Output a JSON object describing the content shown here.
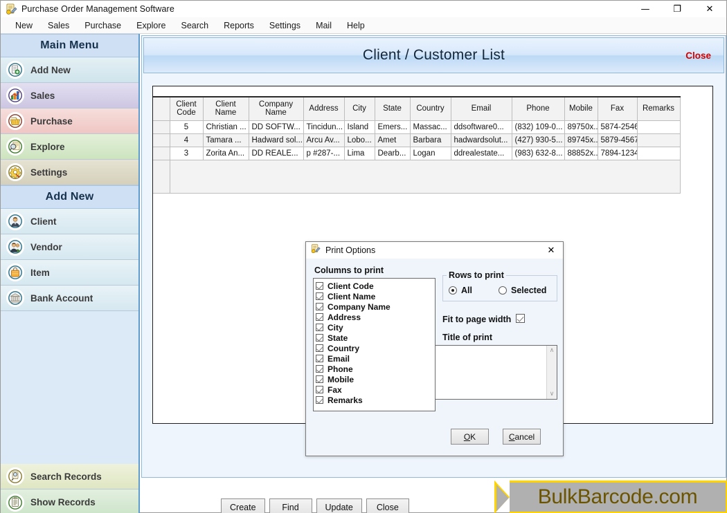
{
  "window": {
    "title": "Purchase Order Management Software",
    "icon": "app-icon",
    "minimize": "—",
    "restore": "❐",
    "close": "✕"
  },
  "menubar": {
    "items": [
      {
        "label": "New"
      },
      {
        "label": "Sales"
      },
      {
        "label": "Purchase"
      },
      {
        "label": "Explore"
      },
      {
        "label": "Search"
      },
      {
        "label": "Reports"
      },
      {
        "label": "Settings"
      },
      {
        "label": "Mail"
      },
      {
        "label": "Help"
      }
    ]
  },
  "sidebar": {
    "main_menu_header": "Main Menu",
    "main_items": [
      {
        "label": "Add New",
        "icon": "document-add-icon"
      },
      {
        "label": "Sales",
        "icon": "bar-chart-icon"
      },
      {
        "label": "Purchase",
        "icon": "basket-icon"
      },
      {
        "label": "Explore",
        "icon": "magnifier-page-icon"
      },
      {
        "label": "Settings",
        "icon": "gear-icon"
      }
    ],
    "add_new_header": "Add New",
    "add_new_items": [
      {
        "label": "Client",
        "icon": "person-icon"
      },
      {
        "label": "Vendor",
        "icon": "people-icon"
      },
      {
        "label": "Item",
        "icon": "shopping-bag-icon"
      },
      {
        "label": "Bank Account",
        "icon": "bank-icon"
      }
    ],
    "bottom_items": [
      {
        "label": "Search Records",
        "icon": "search-records-icon"
      },
      {
        "label": "Show Records",
        "icon": "clipboard-icon"
      }
    ]
  },
  "main": {
    "title": "Client / Customer List",
    "close_label": "Close",
    "buttons": [
      {
        "label": "Create"
      },
      {
        "label": "Find"
      },
      {
        "label": "Update"
      },
      {
        "label": "Close"
      }
    ],
    "tool_icons": [
      {
        "name": "email-icon",
        "active": false
      },
      {
        "name": "excel-export-icon",
        "active": false
      },
      {
        "name": "print-icon",
        "active": true
      },
      {
        "name": "help-icon",
        "active": false
      }
    ]
  },
  "grid": {
    "columns": [
      "Client\nCode",
      "Client\nName",
      "Company\nName",
      "Address",
      "City",
      "State",
      "Country",
      "Email",
      "Phone",
      "Mobile",
      "Fax",
      "Remarks"
    ],
    "column_labels": [
      [
        "Client",
        "Code"
      ],
      [
        "Client",
        "Name"
      ],
      [
        "Company",
        "Name"
      ],
      [
        "Address",
        ""
      ],
      [
        "City",
        ""
      ],
      [
        "State",
        ""
      ],
      [
        "Country",
        ""
      ],
      [
        "Email",
        ""
      ],
      [
        "Phone",
        ""
      ],
      [
        "Mobile",
        ""
      ],
      [
        "Fax",
        ""
      ],
      [
        "Remarks",
        ""
      ]
    ],
    "rows": [
      {
        "client_code": "5",
        "client_name": "Christian ...",
        "company_name": "DD SOFTW...",
        "address": "Tincidun...",
        "city": "Island",
        "state": "Emers...",
        "country": "Massac...",
        "email": "ddsoftware0...",
        "phone": "(832) 109-0...",
        "mobile": "89750x...",
        "fax": "5874-2546",
        "remarks": ""
      },
      {
        "client_code": "4",
        "client_name": "Tamara ...",
        "company_name": "Hadward sol...",
        "address": "Arcu Av...",
        "city": "Lobo...",
        "state": "Amet",
        "country": "Barbara",
        "email": "hadwardsolut...",
        "phone": "(427) 930-5...",
        "mobile": "89745x...",
        "fax": "5879-4567",
        "remarks": ""
      },
      {
        "client_code": "3",
        "client_name": "Zorita An...",
        "company_name": "DD REALE...",
        "address": "p #287-...",
        "city": "Lima",
        "state": "Dearb...",
        "country": "Logan",
        "email": "ddrealestate...",
        "phone": "(983) 632-8...",
        "mobile": "88852x...",
        "fax": "7894-1234",
        "remarks": ""
      }
    ]
  },
  "dialog": {
    "title": "Print Options",
    "icon": "app-icon",
    "close": "✕",
    "columns_label": "Columns to print",
    "columns": [
      {
        "label": "Client Code",
        "checked": true
      },
      {
        "label": "Client Name",
        "checked": true
      },
      {
        "label": "Company Name",
        "checked": true
      },
      {
        "label": "Address",
        "checked": true
      },
      {
        "label": "City",
        "checked": true
      },
      {
        "label": "State",
        "checked": true
      },
      {
        "label": "Country",
        "checked": true
      },
      {
        "label": "Email",
        "checked": true
      },
      {
        "label": "Phone",
        "checked": true
      },
      {
        "label": "Mobile",
        "checked": true
      },
      {
        "label": "Fax",
        "checked": true
      },
      {
        "label": "Remarks",
        "checked": true
      }
    ],
    "rows_label": "Rows to print",
    "rows_all": "All",
    "rows_selected": "Selected",
    "rows_value": "All",
    "fit_label": "Fit to page width",
    "fit_checked": true,
    "title_of_print_label": "Title of print",
    "title_of_print_value": "",
    "title_of_print_placeholder": "",
    "scroll_up": "∧",
    "scroll_down": "∨",
    "ok_label": "OK",
    "ok_mnemonic": "O",
    "ok_rest": "K",
    "cancel_label": "Cancel",
    "cancel_mnemonic": "C",
    "cancel_rest": "ancel"
  },
  "banner": {
    "text": "BulkBarcode.com"
  },
  "colors": {
    "accent_blue": "#5d9ccc",
    "header_gradient_top": "#eaf3fe",
    "close_red": "#d40000",
    "banner_yellow": "#ffd400",
    "banner_gray": "#b0b0b0",
    "banner_text": "#6b5400",
    "print_highlight": "#8b1a1a"
  }
}
